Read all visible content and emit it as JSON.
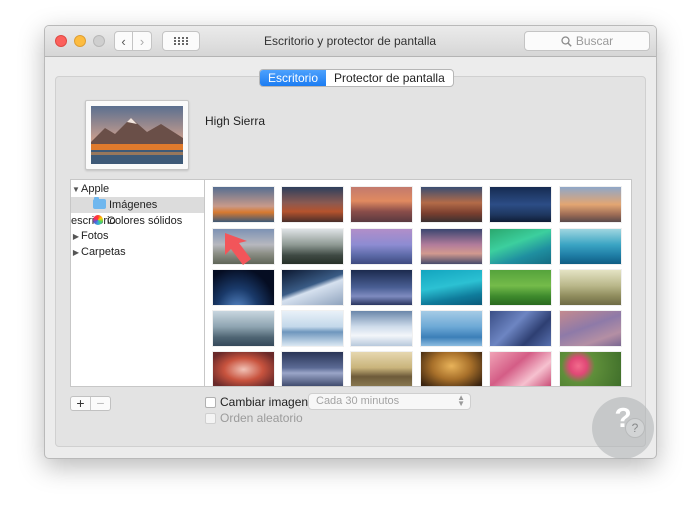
{
  "window": {
    "title": "Escritorio y protector de pantalla",
    "search_placeholder": "Buscar"
  },
  "tabs": [
    {
      "label": "Escritorio",
      "active": true
    },
    {
      "label": "Protector de pantalla",
      "active": false
    }
  ],
  "current_wallpaper": {
    "name": "High Sierra"
  },
  "sidebar": {
    "items": [
      {
        "label": "Apple",
        "expanded": true
      },
      {
        "label": "Imágenes escritorio",
        "icon": "folder-icon",
        "selected": true
      },
      {
        "label": "Colores sólidos",
        "icon": "color-wheel-icon"
      },
      {
        "label": "Fotos",
        "expanded": false
      },
      {
        "label": "Carpetas",
        "expanded": false
      }
    ]
  },
  "controls": {
    "add_label": "+",
    "remove_label": "−",
    "change_image_label": "Cambiar imagen:",
    "change_image_checked": false,
    "interval_value": "Cada 30 minutos",
    "random_order_label": "Orden aleatorio",
    "random_order_checked": false,
    "help_label": "?"
  },
  "watermark": {
    "symbol": "?"
  },
  "accent_color": "#1b7cf2",
  "annotation_arrow_color": "#f2555a"
}
